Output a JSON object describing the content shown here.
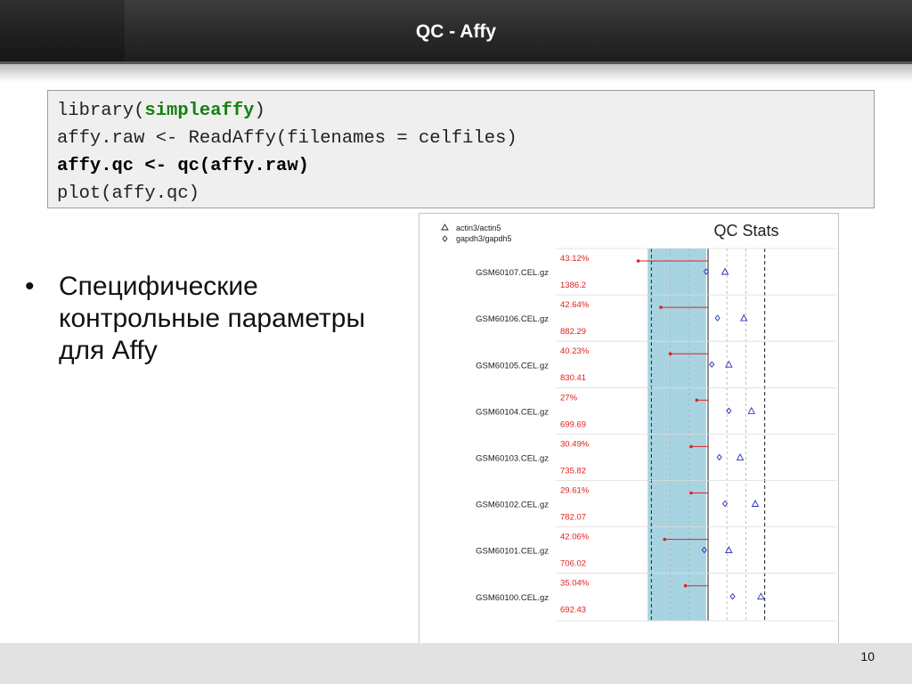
{
  "slide": {
    "title": "QC - Affy",
    "page_number": "10"
  },
  "code": {
    "line1_pre": "library(",
    "line1_kw": "simpleaffy",
    "line1_post": ")",
    "line2": "affy.raw <- ReadAffy(filenames = celfiles)",
    "line3": "affy.qc <- qc(affy.raw)",
    "line4": "plot(affy.qc)"
  },
  "bullets": [
    "Специфические контрольные параметры для Affy"
  ],
  "colors": {
    "code_keyword": "#14800e",
    "band": "#a8d4e2",
    "red": "#e0201e",
    "marker": "#2530b8"
  },
  "chart_data": {
    "type": "scatter",
    "title": "QC Stats",
    "legend": [
      {
        "symbol": "triangle",
        "label": "actin3/actin5"
      },
      {
        "symbol": "diamond",
        "label": "gapdh3/gapdh5"
      }
    ],
    "legend_placement": "top-left",
    "x_ticks": [
      -3,
      -2,
      -1,
      0,
      1,
      2,
      3
    ],
    "xlim": [
      -3.4,
      3.4
    ],
    "scale_band": [
      -3.2,
      -0.1
    ],
    "dashed_lines": [
      -3,
      3
    ],
    "solid_line": 0,
    "samples": [
      {
        "name": "GSM60107.CEL.gz",
        "percent_present": "43.12%",
        "background": "1386.2",
        "scale_factor": -3.7,
        "actin": 0.9,
        "gapdh": -0.1
      },
      {
        "name": "GSM60106.CEL.gz",
        "percent_present": "42.64%",
        "background": "882.29",
        "scale_factor": -2.5,
        "actin": 1.9,
        "gapdh": 0.5
      },
      {
        "name": "GSM60105.CEL.gz",
        "percent_present": "40.23%",
        "background": "830.41",
        "scale_factor": -2.0,
        "actin": 1.1,
        "gapdh": 0.2
      },
      {
        "name": "GSM60104.CEL.gz",
        "percent_present": "27%",
        "background": "699.69",
        "scale_factor": -0.6,
        "actin": 2.3,
        "gapdh": 1.1
      },
      {
        "name": "GSM60103.CEL.gz",
        "percent_present": "30.49%",
        "background": "735.82",
        "scale_factor": -0.9,
        "actin": 1.7,
        "gapdh": 0.6
      },
      {
        "name": "GSM60102.CEL.gz",
        "percent_present": "29.61%",
        "background": "782.07",
        "scale_factor": -0.9,
        "actin": 2.5,
        "gapdh": 0.9
      },
      {
        "name": "GSM60101.CEL.gz",
        "percent_present": "42.06%",
        "background": "706.02",
        "scale_factor": -2.3,
        "actin": 1.1,
        "gapdh": -0.2
      },
      {
        "name": "GSM60100.CEL.gz",
        "percent_present": "35.04%",
        "background": "692.43",
        "scale_factor": -1.2,
        "actin": 2.8,
        "gapdh": 1.3
      }
    ]
  }
}
